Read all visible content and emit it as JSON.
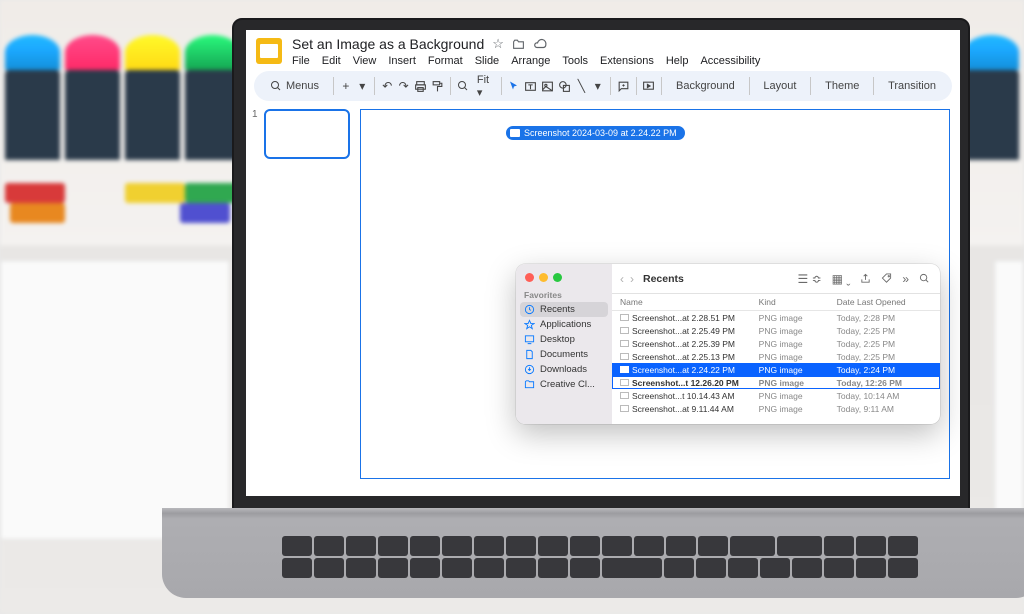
{
  "slides": {
    "title": "Set an Image as a Background",
    "menus": [
      "File",
      "Edit",
      "View",
      "Insert",
      "Format",
      "Slide",
      "Arrange",
      "Tools",
      "Extensions",
      "Help",
      "Accessibility"
    ],
    "search_label": "Menus",
    "zoom": "Fit",
    "toolbar_buttons": [
      "Background",
      "Layout",
      "Theme",
      "Transition"
    ],
    "thumb_number": "1",
    "drag_chip": "Screenshot 2024-03-09 at 2.24.22 PM"
  },
  "finder": {
    "location": "Recents",
    "sidebar_heading": "Favorites",
    "sidebar": [
      {
        "label": "Recents",
        "icon": "clock",
        "selected": true
      },
      {
        "label": "Applications",
        "icon": "app",
        "selected": false
      },
      {
        "label": "Desktop",
        "icon": "desktop",
        "selected": false
      },
      {
        "label": "Documents",
        "icon": "doc",
        "selected": false
      },
      {
        "label": "Downloads",
        "icon": "download",
        "selected": false
      },
      {
        "label": "Creative Cl...",
        "icon": "folder",
        "selected": false
      }
    ],
    "columns": {
      "name": "Name",
      "kind": "Kind",
      "date": "Date Last Opened"
    },
    "files": [
      {
        "name": "Screenshot...at 2.28.51 PM",
        "kind": "PNG image",
        "date": "Today, 2:28 PM",
        "sel": false,
        "dragging": false
      },
      {
        "name": "Screenshot...at 2.25.49 PM",
        "kind": "PNG image",
        "date": "Today, 2:25 PM",
        "sel": false,
        "dragging": false
      },
      {
        "name": "Screenshot...at 2.25.39 PM",
        "kind": "PNG image",
        "date": "Today, 2:25 PM",
        "sel": false,
        "dragging": false
      },
      {
        "name": "Screenshot...at 2.25.13 PM",
        "kind": "PNG image",
        "date": "Today, 2:25 PM",
        "sel": false,
        "dragging": false
      },
      {
        "name": "Screenshot...at 2.24.22 PM",
        "kind": "PNG image",
        "date": "Today, 2:24 PM",
        "sel": true,
        "dragging": false
      },
      {
        "name": "Screenshot...t 12.26.20 PM",
        "kind": "PNG image",
        "date": "Today, 12:26 PM",
        "sel": false,
        "dragging": true
      },
      {
        "name": "Screenshot...t 10.14.43 AM",
        "kind": "PNG image",
        "date": "Today, 10:14 AM",
        "sel": false,
        "dragging": false
      },
      {
        "name": "Screenshot...at 9.11.44 AM",
        "kind": "PNG image",
        "date": "Today, 9:11 AM",
        "sel": false,
        "dragging": false
      }
    ]
  }
}
